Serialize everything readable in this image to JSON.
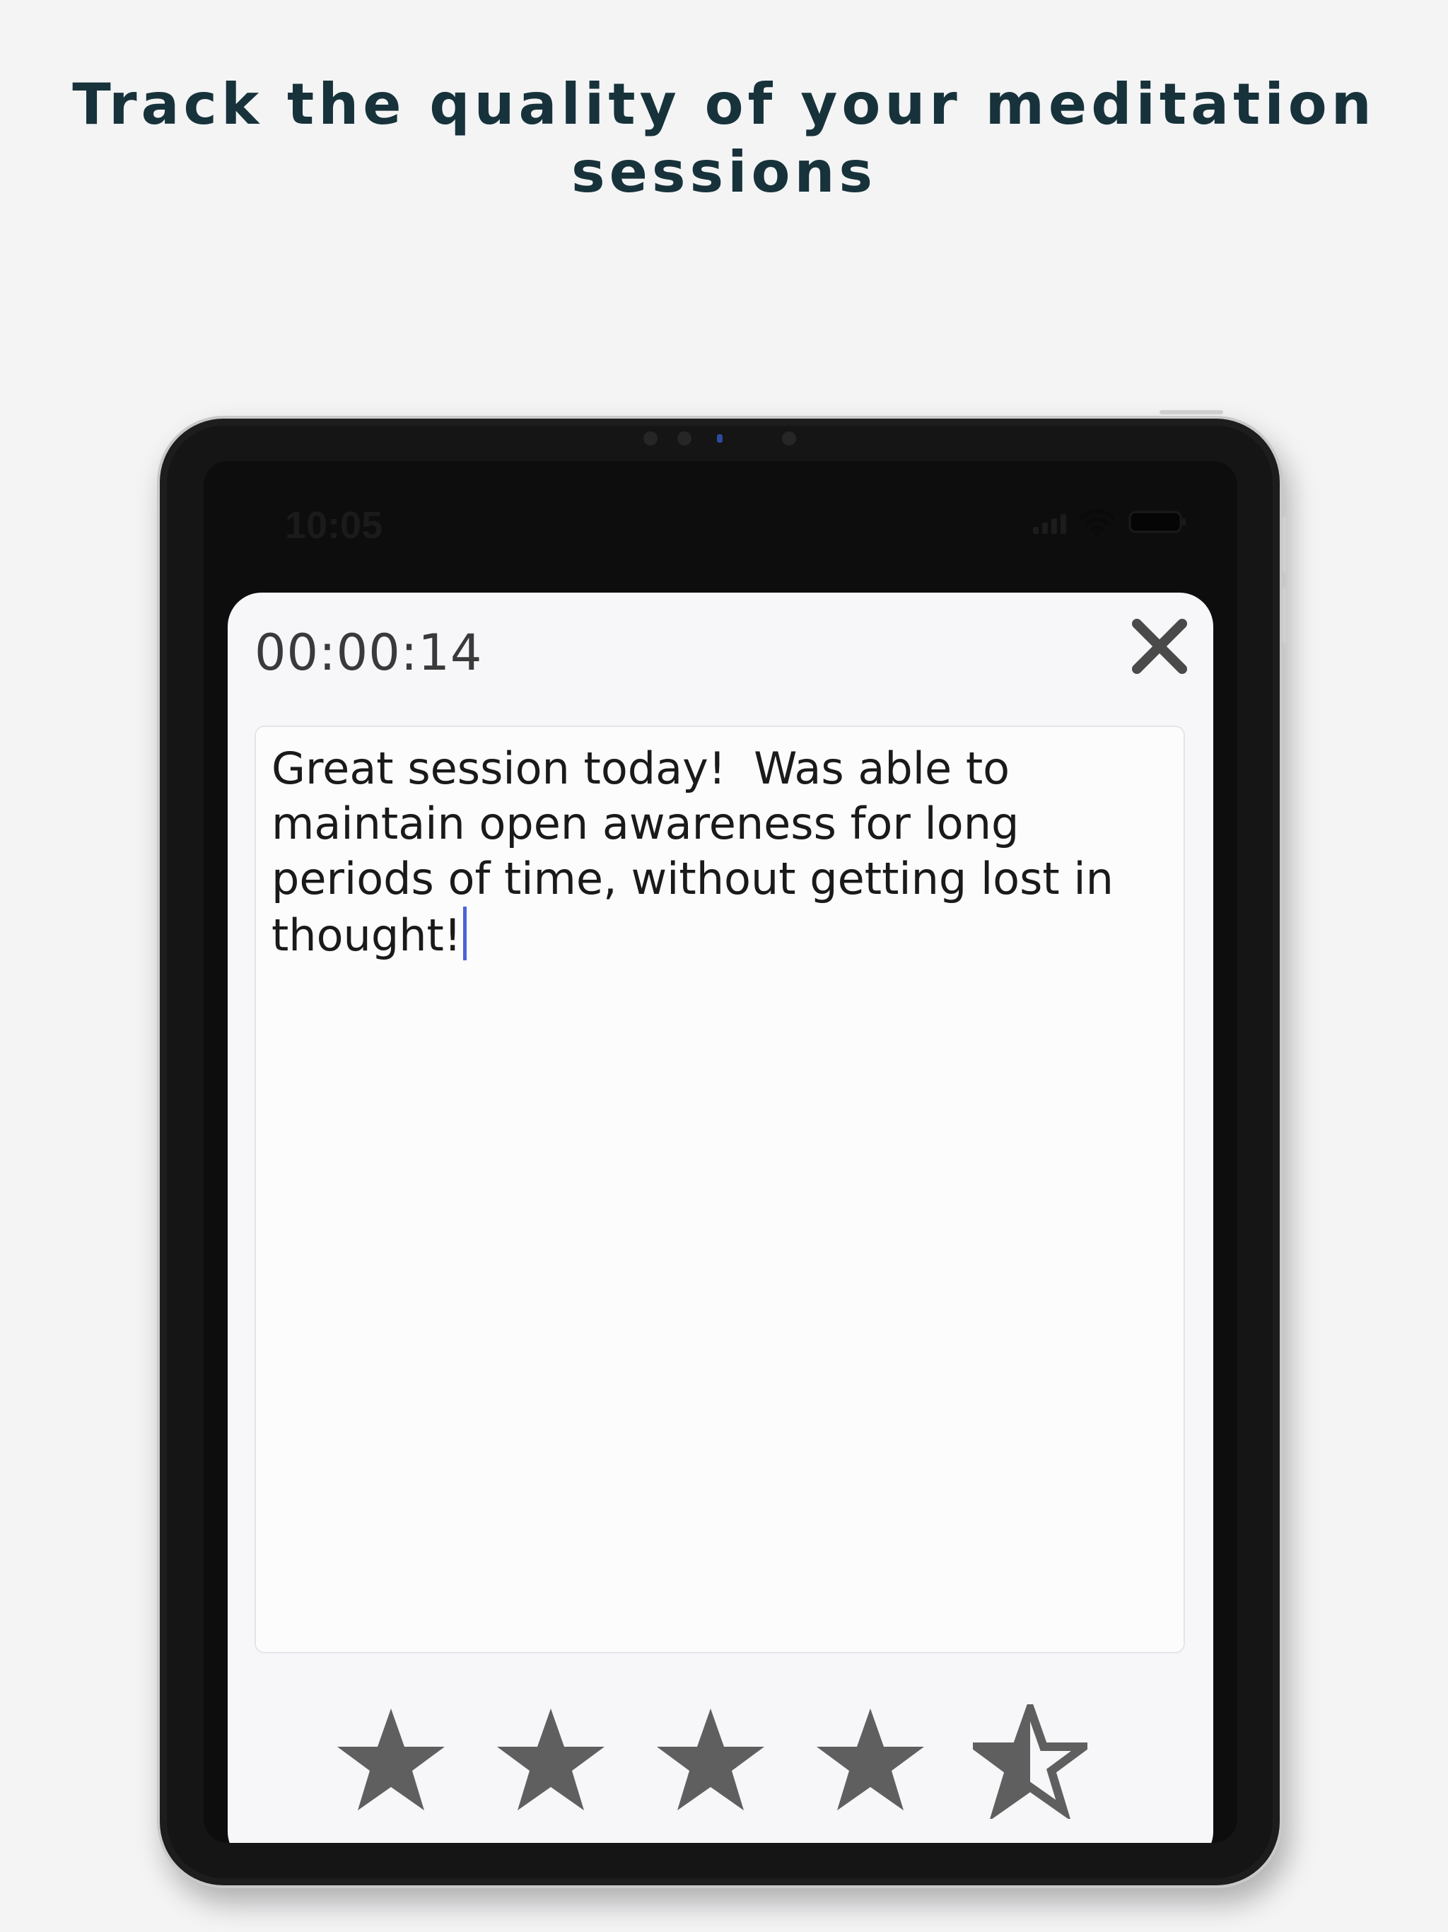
{
  "headline": {
    "line1": "Track the quality of your meditation",
    "line2": "sessions"
  },
  "status_bar": {
    "time": "10:05",
    "icons": [
      "signal-icon",
      "wifi-icon",
      "battery-icon"
    ]
  },
  "session": {
    "timer": "00:00:14",
    "close_icon": "close-icon",
    "note_text": "Great session today!  Was able to maintain open awareness for long periods of time, without getting lost in thought!",
    "rating": {
      "value": 4.5,
      "max": 5,
      "icon": "star-icon"
    }
  },
  "colors": {
    "background": "#f4f4f5",
    "headline": "#17323a",
    "device_frame": "#151515",
    "sheet": "#f7f6f9",
    "star": "#5f5f5f",
    "caret": "#4a64d8"
  }
}
